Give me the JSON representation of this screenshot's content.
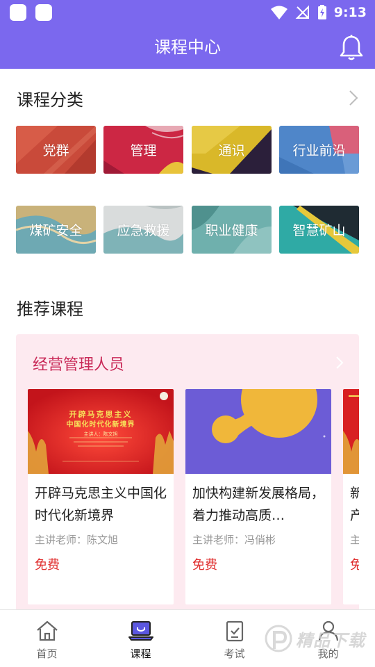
{
  "header": {
    "title": "课程中心",
    "time": "9:13"
  },
  "categories": {
    "title": "课程分类",
    "items": [
      {
        "label": "党群"
      },
      {
        "label": "管理"
      },
      {
        "label": "通识"
      },
      {
        "label": "行业前沿"
      },
      {
        "label": "煤矿安全"
      },
      {
        "label": "应急救援"
      },
      {
        "label": "职业健康"
      },
      {
        "label": "智慧矿山"
      }
    ]
  },
  "recommended": {
    "title": "推荐课程",
    "group_title": "经营管理人员",
    "courses": [
      {
        "title": "开辟马克思主义中国化时代化新境界",
        "teacher": "主讲老师：陈文旭",
        "price": "免费",
        "poster_lines": [
          "开辟马克思主义",
          "中国化时代化新境界"
        ],
        "poster_speaker": "主讲人：陈文旭"
      },
      {
        "title": "加快构建新发展格局，着力推动高质…",
        "teacher": "主讲老师：冯俏彬",
        "price": "免费"
      },
      {
        "title": "新产",
        "teacher": "主",
        "price": "免"
      }
    ]
  },
  "tabs": [
    {
      "label": "首页",
      "icon": "home-icon"
    },
    {
      "label": "课程",
      "icon": "course-laptop-icon"
    },
    {
      "label": "考试",
      "icon": "exam-checklist-icon"
    },
    {
      "label": "我的",
      "icon": "profile-icon"
    }
  ],
  "watermark": {
    "text": "精品下载"
  },
  "colors": {
    "primary": "#7b68ee",
    "accent_text": "#c92a58",
    "price": "#e02f2f",
    "panel_bg": "#fdeaf0"
  }
}
